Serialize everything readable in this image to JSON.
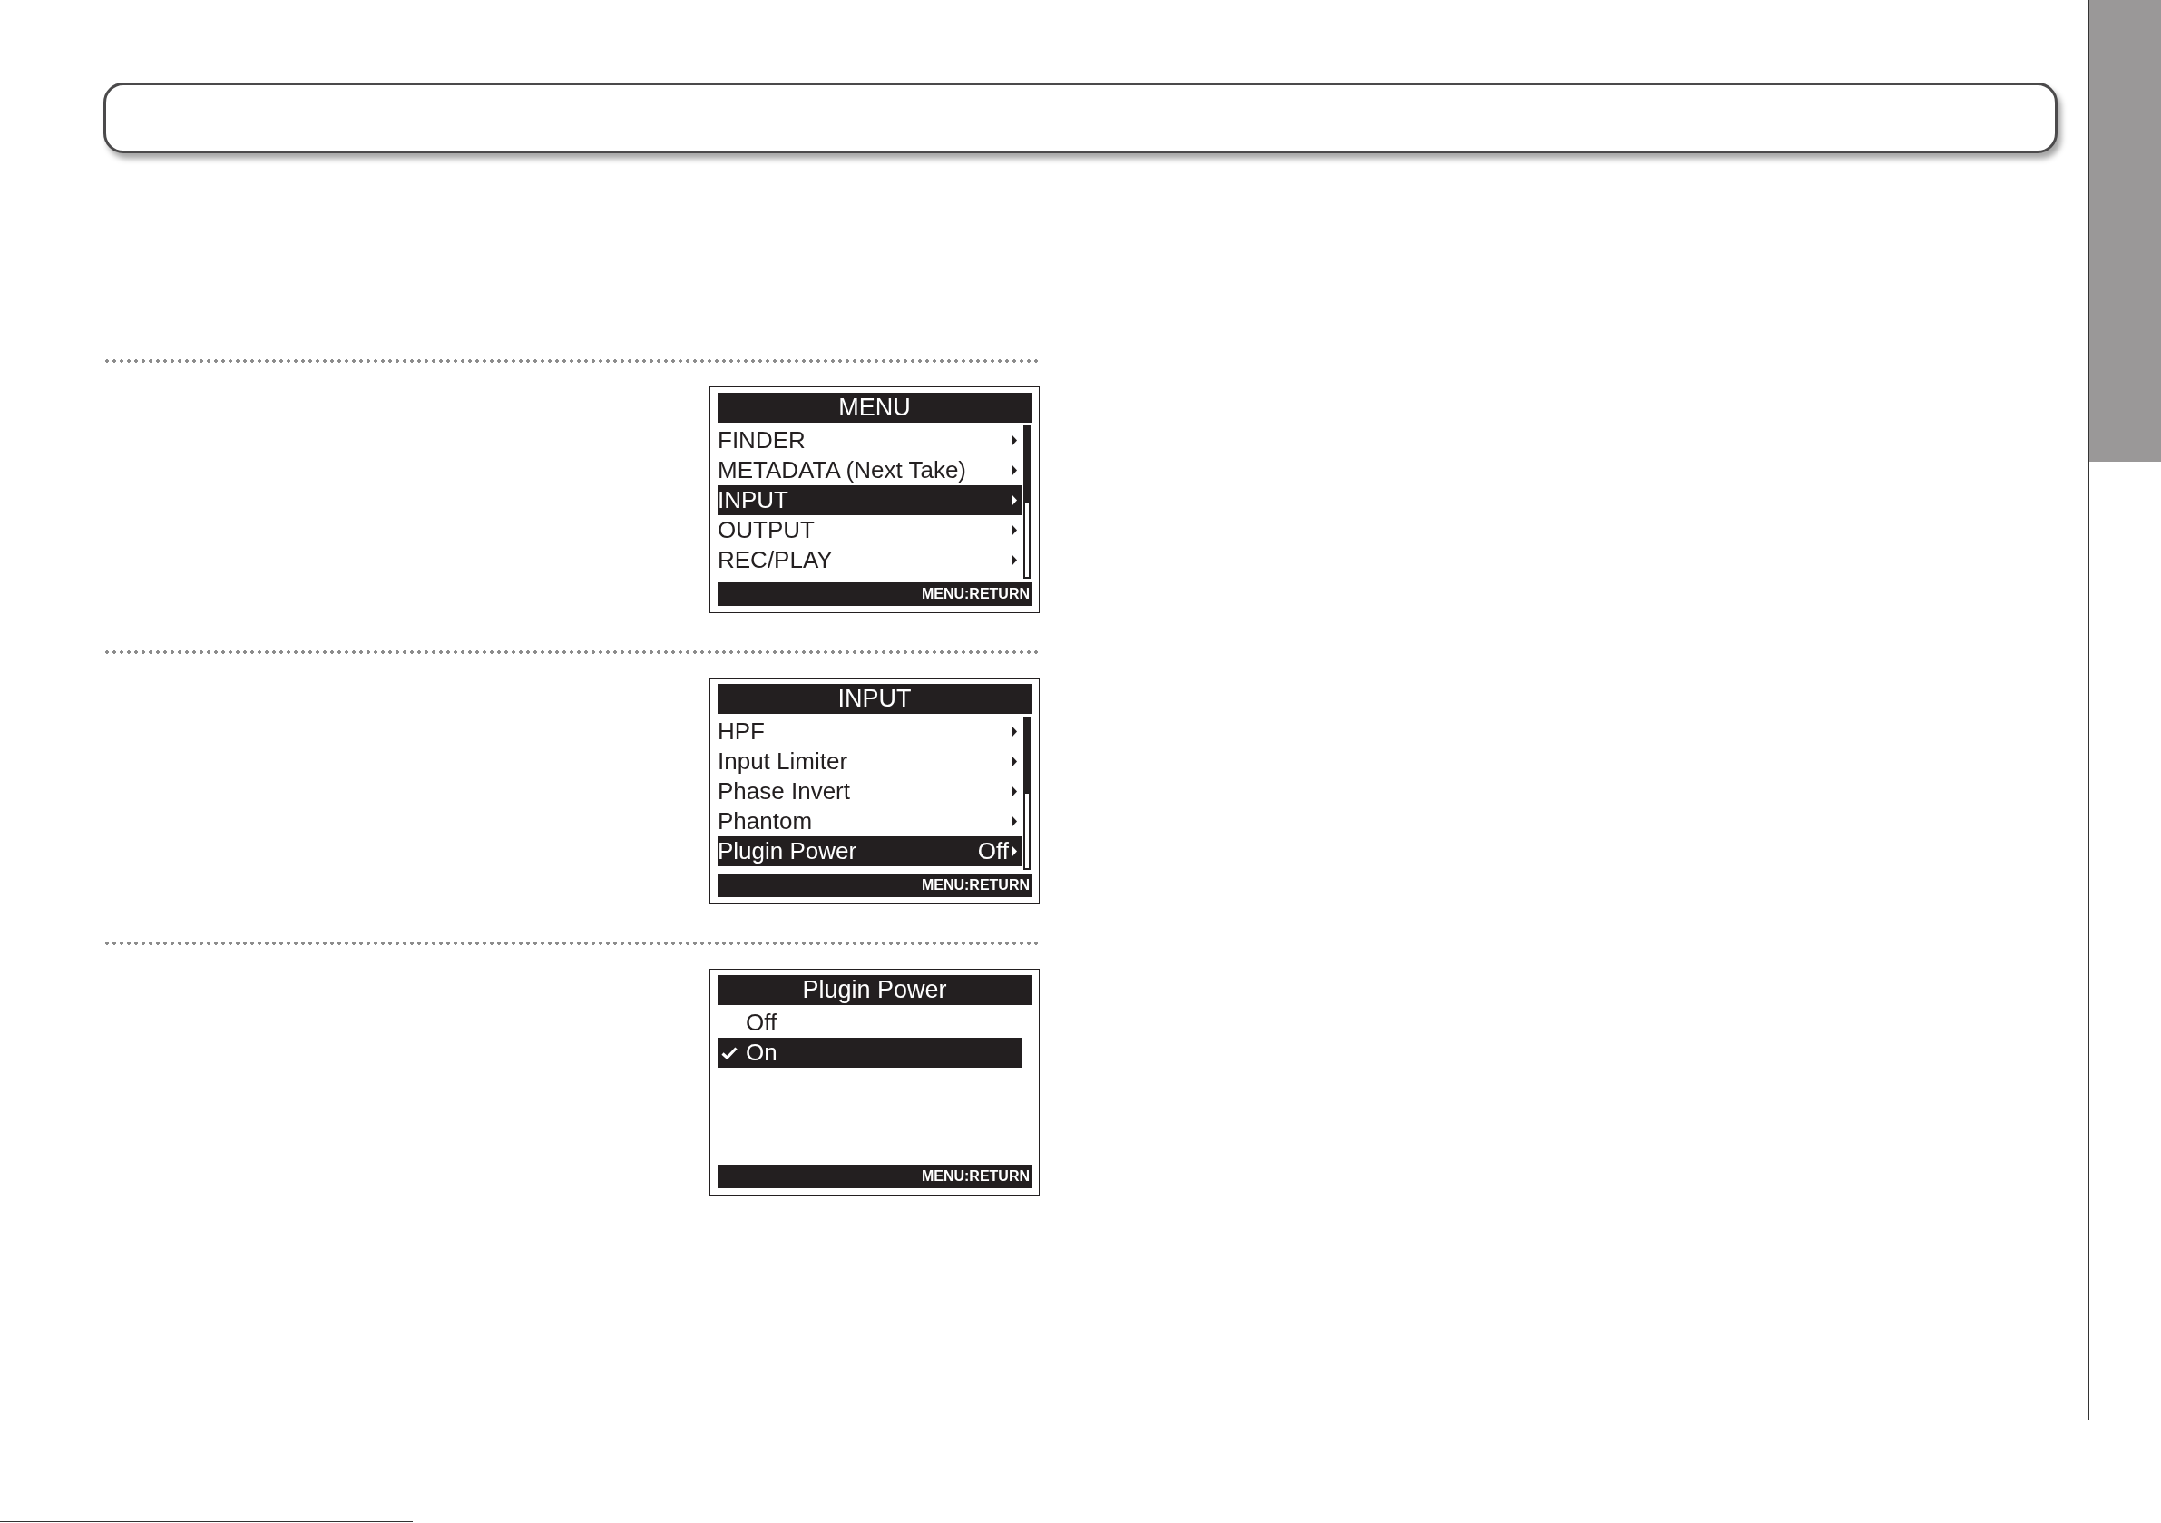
{
  "screens": [
    {
      "kind": "menu",
      "title": "MENU",
      "items": [
        {
          "label": "FINDER",
          "selected": false
        },
        {
          "label": "METADATA (Next Take)",
          "selected": false
        },
        {
          "label": "INPUT",
          "selected": true
        },
        {
          "label": "OUTPUT",
          "selected": false
        },
        {
          "label": "REC/PLAY",
          "selected": false
        }
      ],
      "footer": "MENU:RETURN"
    },
    {
      "kind": "menu",
      "title": "INPUT",
      "items": [
        {
          "label": "HPF",
          "selected": false
        },
        {
          "label": "Input Limiter",
          "selected": false
        },
        {
          "label": "Phase Invert",
          "selected": false
        },
        {
          "label": "Phantom",
          "selected": false
        },
        {
          "label": "Plugin Power",
          "value": "Off",
          "selected": true
        }
      ],
      "footer": "MENU:RETURN"
    },
    {
      "kind": "options",
      "title": "Plugin Power",
      "items": [
        {
          "label": "Off",
          "selected": false,
          "checked": false
        },
        {
          "label": "On",
          "selected": true,
          "checked": true
        }
      ],
      "footer": "MENU:RETURN"
    }
  ]
}
